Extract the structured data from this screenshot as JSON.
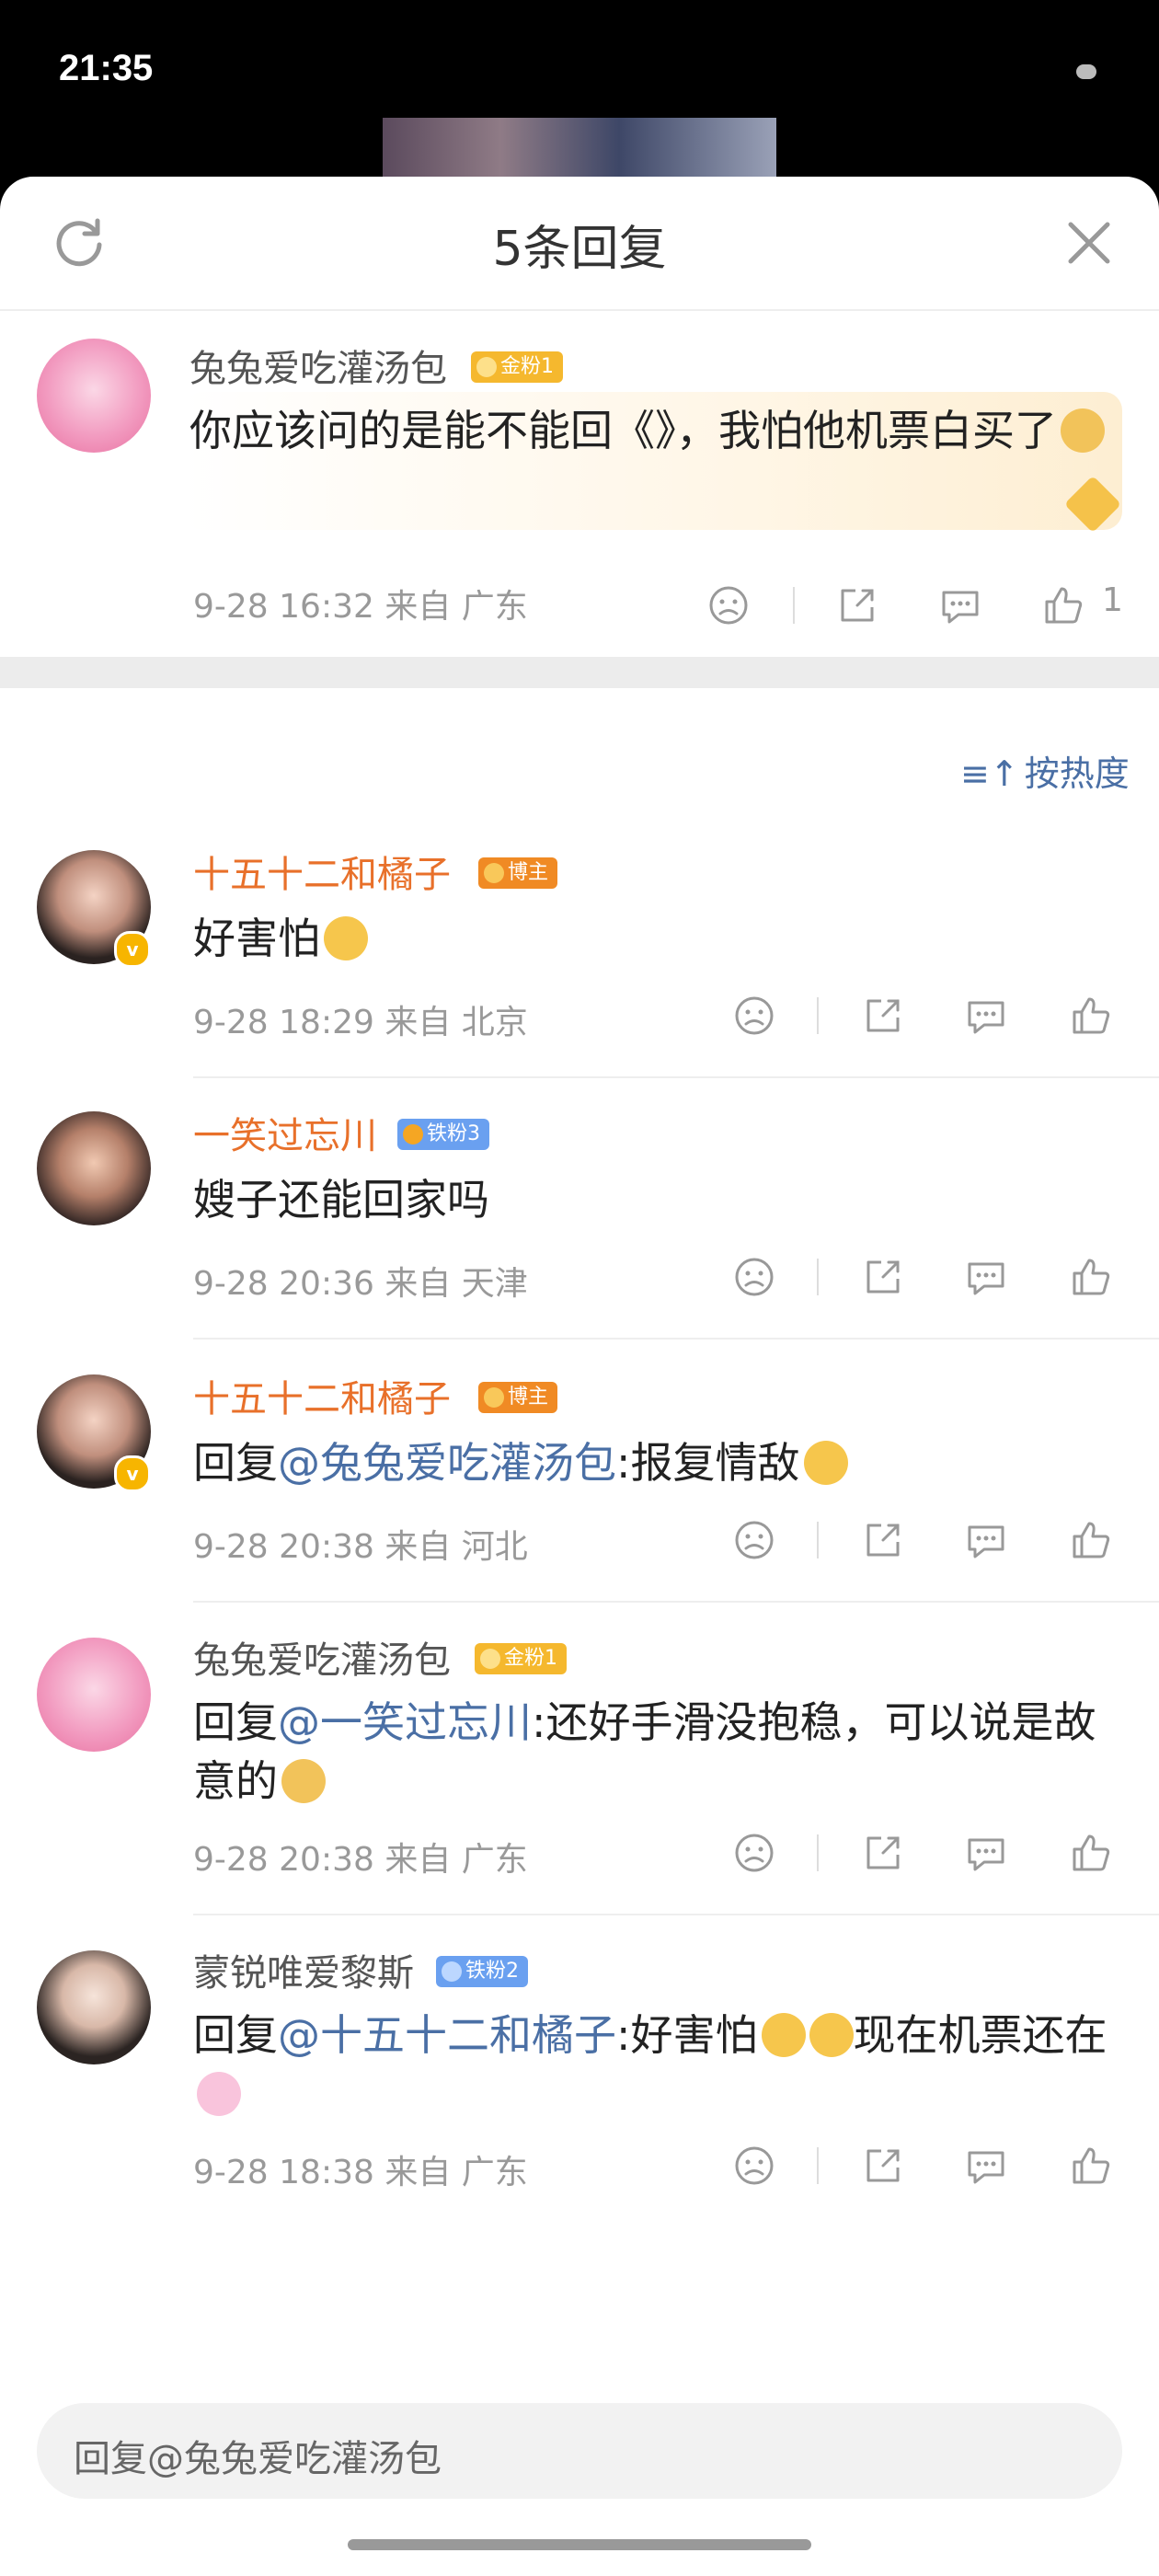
{
  "status_bar": {
    "time": "21:35"
  },
  "sheet": {
    "title": "5条回复"
  },
  "root_comment": {
    "username": "兔兔爱吃灌汤包",
    "badge": "金粉1",
    "text": "你应该问的是能不能回《》，我怕他机票白买了",
    "timestamp": "9-28 16:32",
    "location": "来自 广东",
    "like_count": "1"
  },
  "sort_label": "按热度",
  "replies": [
    {
      "username": "十五十二和橘子",
      "badge": "博主",
      "text": "好害怕",
      "timestamp": "9-28 18:29",
      "location": "来自 北京"
    },
    {
      "username": "一笑过忘川",
      "badge": "铁粉3",
      "text": "嫂子还能回家吗",
      "timestamp": "9-28 20:36",
      "location": "来自 天津"
    },
    {
      "username": "十五十二和橘子",
      "badge": "博主",
      "prefix": "回复",
      "mention": "@兔兔爱吃灌汤包",
      "text": ":报复情敌",
      "timestamp": "9-28 20:38",
      "location": "来自 河北"
    },
    {
      "username": "兔兔爱吃灌汤包",
      "badge": "金粉1",
      "prefix": "回复",
      "mention": "@一笑过忘川",
      "text": ":还好手滑没抱稳，可以说是故意的",
      "timestamp": "9-28 20:38",
      "location": "来自 广东"
    },
    {
      "username": "蒙锐唯爱黎斯",
      "badge": "铁粉2",
      "prefix": "回复",
      "mention": "@十五十二和橘子",
      "text": ":好害怕",
      "text2": "现在机票还在",
      "timestamp": "9-28 18:38",
      "location": "来自 广东"
    }
  ],
  "reply_input": {
    "placeholder": "回复@兔兔爱吃灌汤包"
  },
  "colors": {
    "accent_orange": "#e8702a",
    "link_blue": "#4a6fa5",
    "gold_badge": "#f5b82e",
    "blogger_badge": "#f08a24",
    "iron_badge": "#6aa0f0"
  },
  "icons": [
    "refresh-icon",
    "close-icon",
    "dislike-icon",
    "share-icon",
    "comment-icon",
    "like-icon",
    "sort-icon",
    "verified-icon"
  ]
}
